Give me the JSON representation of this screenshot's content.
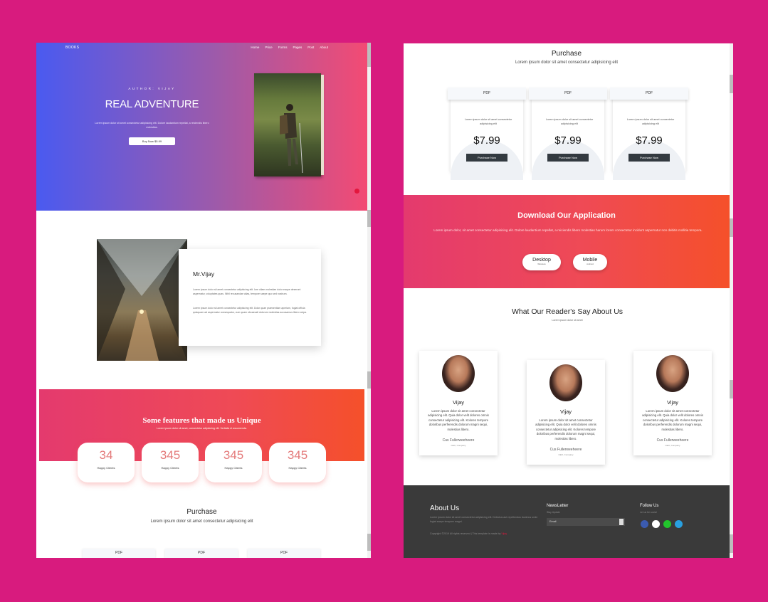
{
  "colors": {
    "background": "#d81b7e",
    "accent": "#f5502a",
    "price_button": "#333a40",
    "footer": "#3a3a3a",
    "link_red": "#e3173e"
  },
  "hero": {
    "brand": "BOOKS",
    "nav": [
      "Home",
      "Price",
      "Forms",
      "Pages",
      "Post",
      "About"
    ],
    "subtitle": "AUTHOR: VIJAY",
    "title": "REAL ADVENTURE",
    "text": "Lorem ipsum dolor sit amet consectetur adipisicing elit. Dolore laudantium repellat, a reiciendis libero molestias.",
    "button": "Buy Now $5.99"
  },
  "author": {
    "name": "Mr.Vijay",
    "para1": "Lorem ipsum dolor sit amet consectetur adipisicing elit. Iure ullam molestiae dolor eaque deserunt aspernatur, voluptates quas. Nihil recusandae alias, tempore saepe quo sed nostrum.",
    "para2": "Lorem ipsum dolor sit amet consectetur adipisicing elit. Dolor quae praesentium aperiam, fugiat officia quisquam ad aspernatur consequatur, cum quam obcaecati dolorum molestias accusamus libero culpa."
  },
  "features": {
    "title": "Some features that made us Unique",
    "subtitle": "Lorem ipsum dolor sit amet, consectetur adipisicing elit. Veritatis et assumenda.",
    "counters": [
      {
        "value": "34",
        "label": "Happy Clients"
      },
      {
        "value": "345",
        "label": "Happy Clients"
      },
      {
        "value": "345",
        "label": "Happy Clients"
      },
      {
        "value": "345",
        "label": "Happy Clients"
      }
    ]
  },
  "purchase": {
    "title": "Purchase",
    "subtitle": "Lorem ipsum dolor sit amet consectetur adipisicing elit",
    "cards": [
      {
        "tab": "PDF",
        "desc": "Lorem ipsum dolor sit amet consectetur adipisicing elit",
        "price": "$7.99",
        "button": "Purchase Now"
      },
      {
        "tab": "PDF",
        "desc": "Lorem ipsum dolor sit amet consectetur adipisicing elit",
        "price": "$7.99",
        "button": "Purchase Now"
      },
      {
        "tab": "PDF",
        "desc": "Lorem ipsum dolor sit amet consectetur adipisicing elit",
        "price": "$7.99",
        "button": "Purchase Now"
      }
    ]
  },
  "app": {
    "title": "Download Our Application",
    "text": "Lorem ipsum dolor, sit amet consectetur adipisicing elit. Dolore laudantium repellat, a reiciendis libero molestias harum lorem consectetur incidunt aspernatur non debitis mollitia tempora.",
    "buttons": [
      {
        "label": "Desktop",
        "sub": "Windows"
      },
      {
        "label": "Mobile",
        "sub": "Android"
      }
    ]
  },
  "reviews": {
    "title": "What Our Reader's Say About Us",
    "subtitle": "Lorem ipsum dolor sit amet",
    "cards": [
      {
        "name": "Vijay",
        "text": "Lorem ipsum dolor sit amet consectetur adipisicing elit. Quia dolor velit dolores omnis consectetur adipisicing elit. Kolores tempore doloribus perferendis dolorum magni sequi, molestias libero.",
        "sign": "Cus Fullerweeheere",
        "role": "CEO, Company"
      },
      {
        "name": "Vijay",
        "text": "Lorem ipsum dolor sit amet consectetur adipisicing elit. Quia dolor velit dolores omnis consectetur adipisicing elit. Kolores tempore doloribus perferendis dolorum magni sequi, molestias libero.",
        "sign": "Cus Fullerweeheere",
        "role": "CEO, Company"
      },
      {
        "name": "Vijay",
        "text": "Lorem ipsum dolor sit amet consectetur adipisicing elit. Quia dolor velit dolores omnis consectetur adipisicing elit. Kolores tempore doloribus perferendis dolorum magni sequi, molestias libero.",
        "sign": "Cus Fullerweeheere",
        "role": "CEO, Company"
      }
    ]
  },
  "footer": {
    "about_title": "About Us",
    "about_text": "Lorem ipsum dolor sit amet consectetur adipisicing elit. Delectus aut repellendus ducimus unde fugiat saepe tempore magni.",
    "copyright": "Copyright ©2019 All rights reserved | This template is made by",
    "copyright_link": "Vijay",
    "newsletter_title": "NewsLetter",
    "newsletter_sub": "Stay Update",
    "newsletter_placeholder": "Email",
    "follow_title": "Follow Us",
    "follow_sub": "Let us be social",
    "social": [
      {
        "icon": "facebook-icon",
        "color": "#3b5bb0"
      },
      {
        "icon": "twitter-icon",
        "color": "#ffffff"
      },
      {
        "icon": "whatsapp-icon",
        "color": "#22c42c"
      },
      {
        "icon": "skype-icon",
        "color": "#29a0e0"
      }
    ]
  }
}
